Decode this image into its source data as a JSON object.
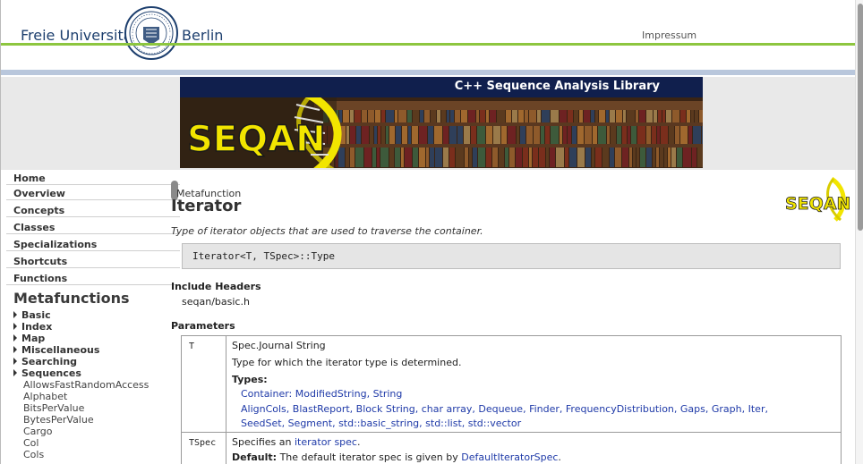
{
  "header": {
    "university_left": "Freie Universität",
    "university_right": "Berlin",
    "impressum": "Impressum",
    "seal_icon": "university-seal-icon"
  },
  "banner": {
    "title": "C++ Sequence Analysis Library",
    "logo_text": "SEQAN"
  },
  "colors": {
    "fu_blue": "#1d3f6e",
    "fu_green": "#8dc63f",
    "banner_navy": "#101f4d",
    "seqan_yellow": "#f2e500",
    "link": "#1f3aa8"
  },
  "sidebar": {
    "nav": [
      "Home",
      "Overview",
      "Concepts",
      "Classes",
      "Specializations",
      "Shortcuts",
      "Functions"
    ],
    "heading": "Metafunctions",
    "tree": [
      "Basic",
      "Index",
      "Map",
      "Miscellaneous",
      "Searching",
      "Sequences"
    ],
    "metafunctions": [
      "AllowsFastRandomAccess",
      "Alphabet",
      "BitsPerValue",
      "BytesPerValue",
      "Cargo",
      "Col",
      "Cols"
    ]
  },
  "main": {
    "kind": "Metafunction",
    "title": "Iterator",
    "summary": "Type of iterator objects that are used to traverse the container.",
    "signature": "Iterator<T, TSpec>::Type",
    "include_heading": "Include Headers",
    "include_file": "seqan/basic.h",
    "params_heading": "Parameters",
    "params": [
      {
        "name": "T",
        "type_line": "Spec.Journal String",
        "description": "Type for which the iterator type is determined.",
        "types_label": "Types:",
        "types_line1": [
          "Container:",
          "ModifiedString",
          "String"
        ],
        "types_line2": [
          "AlignCols",
          "BlastReport",
          "Block String",
          "char array",
          "Dequeue",
          "Finder",
          "FrequencyDistribution",
          "Gaps",
          "Graph",
          "Iter"
        ],
        "types_line3": [
          "SeedSet",
          "Segment",
          "std::basic_string",
          "std::list",
          "std::vector"
        ]
      },
      {
        "name": "TSpec",
        "desc_prefix": "Specifies an",
        "desc_link": "iterator spec",
        "desc_suffix": ".",
        "default_label": "Default:",
        "default_text": "The default iterator spec is given by",
        "default_link": "DefaultIteratorSpec",
        "default_suffix": "."
      }
    ]
  }
}
